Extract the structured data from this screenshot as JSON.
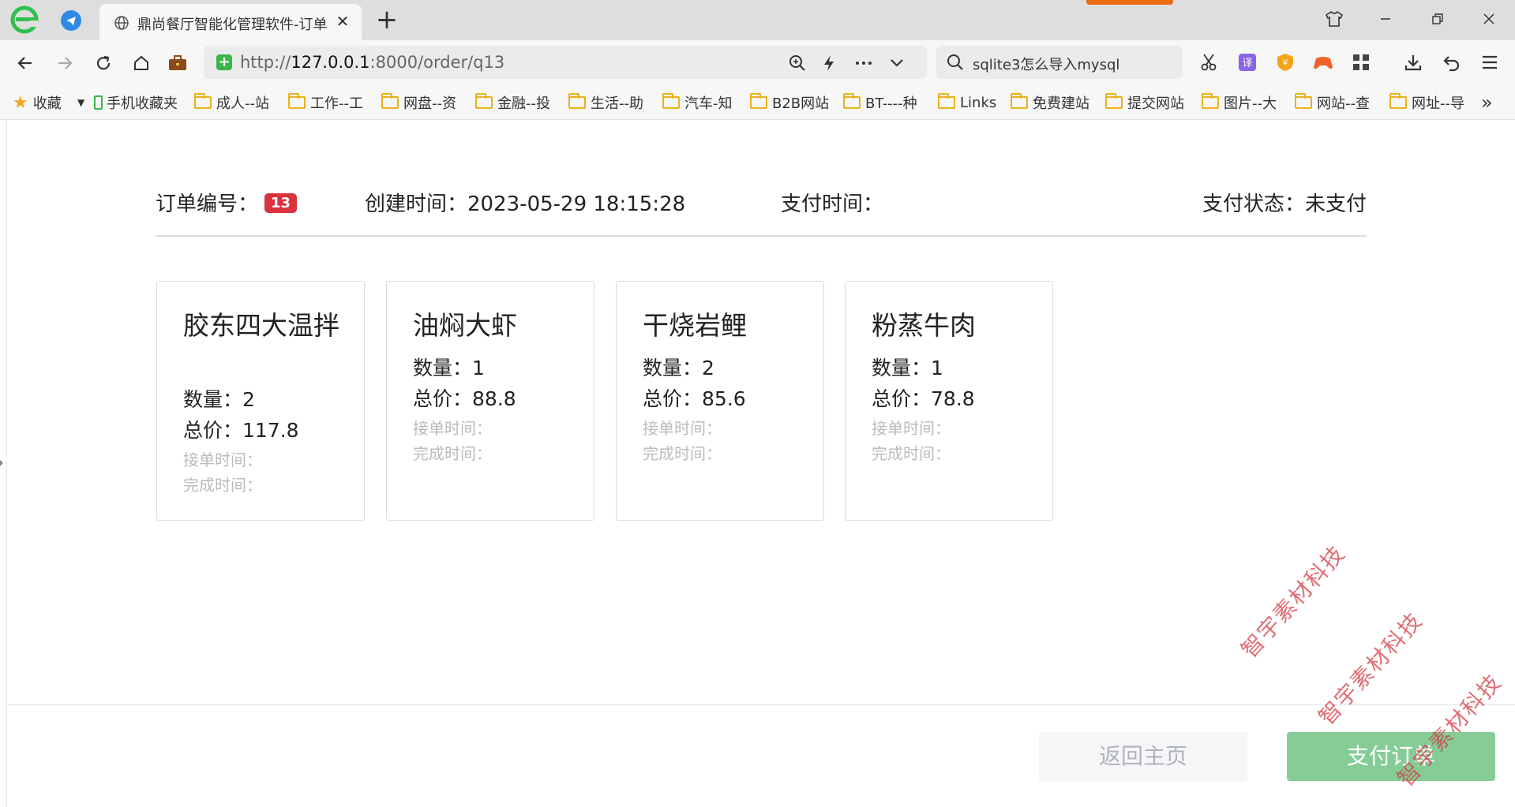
{
  "browser": {
    "tab_title": "鼎尚餐厅智能化管理软件-订单",
    "url_scheme": "http://",
    "url_host": "127.0.0.1",
    "url_path": ":8000/order/q13",
    "search_value": "sqlite3怎么导入mysql"
  },
  "bookmarks": [
    {
      "label": "收藏",
      "icon": "star-icon"
    },
    {
      "label": "手机收藏夹",
      "icon": "phone-icon"
    },
    {
      "label": "成人--站",
      "icon": "folder-icon"
    },
    {
      "label": "工作--工",
      "icon": "folder-icon"
    },
    {
      "label": "网盘--资",
      "icon": "folder-icon"
    },
    {
      "label": "金融--投",
      "icon": "folder-icon"
    },
    {
      "label": "生活--助",
      "icon": "folder-icon"
    },
    {
      "label": "汽车-知",
      "icon": "folder-icon"
    },
    {
      "label": "B2B网站",
      "icon": "folder-icon"
    },
    {
      "label": "BT----种",
      "icon": "folder-icon"
    },
    {
      "label": "Links",
      "icon": "folder-icon"
    },
    {
      "label": "免费建站",
      "icon": "folder-icon"
    },
    {
      "label": "提交网站",
      "icon": "folder-icon"
    },
    {
      "label": "图片--大",
      "icon": "folder-icon"
    },
    {
      "label": "网站--查",
      "icon": "folder-icon"
    },
    {
      "label": "网址--导",
      "icon": "folder-icon"
    }
  ],
  "order": {
    "number_label": "订单编号：",
    "number": "13",
    "created_label": "创建时间：",
    "created": "2023-05-29 18:15:28",
    "paid_label": "支付时间：",
    "paid": "",
    "status_label": "支付状态：",
    "status": "未支付"
  },
  "items": [
    {
      "name": "胶东四大温拌",
      "qty_label": "数量：",
      "qty": "2",
      "total_label": "总价：",
      "total": "117.8",
      "accept_label": "接单时间：",
      "done_label": "完成时间："
    },
    {
      "name": "油焖大虾",
      "qty_label": "数量：",
      "qty": "1",
      "total_label": "总价：",
      "total": "88.8",
      "accept_label": "接单时间：",
      "done_label": "完成时间："
    },
    {
      "name": "干烧岩鲤",
      "qty_label": "数量：",
      "qty": "2",
      "total_label": "总价：",
      "total": "85.6",
      "accept_label": "接单时间：",
      "done_label": "完成时间："
    },
    {
      "name": "粉蒸牛肉",
      "qty_label": "数量：",
      "qty": "1",
      "total_label": "总价：",
      "total": "78.8",
      "accept_label": "接单时间：",
      "done_label": "完成时间："
    }
  ],
  "actions": {
    "back": "返回主页",
    "pay": "支付订单"
  },
  "watermark": "智宇素材科技",
  "colors": {
    "badge": "#d9333f",
    "pay_button": "#86cc96",
    "back_button_text": "#b0b3b8",
    "watermark": "#d63c46"
  }
}
